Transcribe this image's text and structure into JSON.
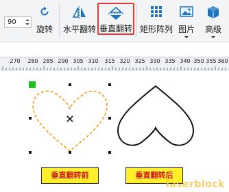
{
  "toolbar": {
    "rotate_value": "90",
    "buttons": {
      "rotate": "旋转",
      "flip_horizontal": "水平翻转",
      "flip_vertical": "垂直翻转",
      "rect_array": "矩形阵列",
      "image": "图片",
      "advanced": "高级"
    }
  },
  "ruler": {
    "labels": [
      "270",
      "280",
      "285",
      "290",
      "305",
      "310",
      "315",
      "320",
      "325",
      "330",
      "335",
      "340",
      "350",
      "355",
      "360"
    ]
  },
  "canvas": {
    "caption_before": "垂直翻转前",
    "caption_after": "垂直翻转后",
    "watermark": "laserblock"
  },
  "colors": {
    "highlight": "#e53935",
    "selected_outline": "#f39c12",
    "caption_bg": "#ffef2a",
    "caption_text": "#d11a1a",
    "handle_green": "#20c020"
  }
}
